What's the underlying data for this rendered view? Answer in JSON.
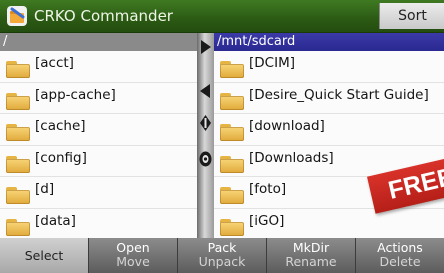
{
  "app": {
    "title": "CRKO Commander",
    "sort_label": "Sort"
  },
  "left_panel": {
    "path": "/",
    "items": [
      "[acct]",
      "[app-cache]",
      "[cache]",
      "[config]",
      "[d]",
      "[data]"
    ]
  },
  "right_panel": {
    "path": "/mnt/sdcard",
    "items": [
      "[DCIM]",
      "[Desire_Quick Start Guide]",
      "[download]",
      "[Downloads]",
      "[foto]",
      "[iGO]"
    ]
  },
  "badge": {
    "text": "FREE"
  },
  "toolbar": {
    "select": "Select",
    "open": "Open",
    "move": "Move",
    "pack": "Pack",
    "unpack": "Unpack",
    "mkdir": "MkDir",
    "rename": "Rename",
    "actions": "Actions",
    "delete": "Delete"
  },
  "colors": {
    "title_bar": "#2f6618",
    "active_path_bar": "#2f2e9c",
    "inactive_path_bar": "#8a8a8a",
    "folder": "#f0c052",
    "free_badge": "#c8271f"
  }
}
